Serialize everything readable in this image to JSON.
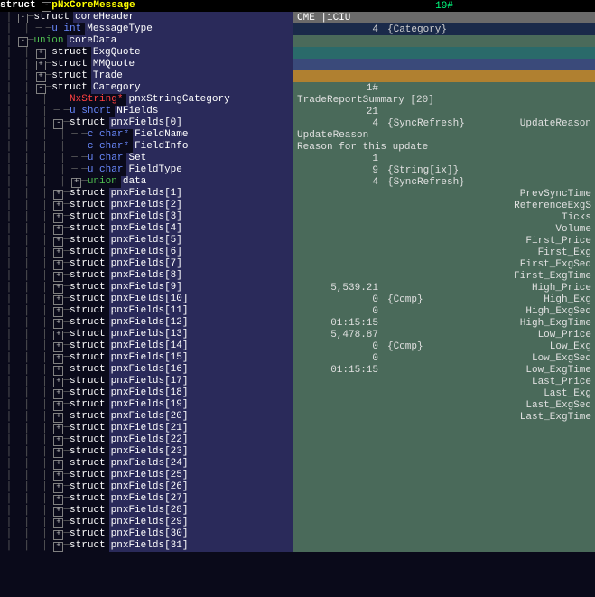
{
  "header": {
    "left_type": "struct",
    "left_name": "pNxCoreMessage",
    "right": "19#"
  },
  "rows": [
    {
      "i": 0,
      "ind": 1,
      "exp": "-",
      "type": "struct",
      "tcls": "type-struct",
      "name": "coreHeader",
      "rcls": "r-grey",
      "rtext": " CME |iCIU"
    },
    {
      "i": 1,
      "ind": 2,
      "exp": "",
      "type": "u int",
      "tcls": "type-uint",
      "name": "MessageType",
      "rcls": "r-dblue",
      "rnum": "4",
      "rtag": "{Category}"
    },
    {
      "i": 2,
      "ind": 1,
      "exp": "-",
      "type": "union",
      "tcls": "type-union",
      "name": "coreData",
      "rcls": "r-green",
      "rtext": ""
    },
    {
      "i": 3,
      "ind": 2,
      "exp": "+",
      "type": "struct",
      "tcls": "type-struct",
      "name": "ExgQuote",
      "rcls": "r-teal",
      "rtext": ""
    },
    {
      "i": 4,
      "ind": 2,
      "exp": "+",
      "type": "struct",
      "tcls": "type-struct",
      "name": "MMQuote",
      "rcls": "r-blue2",
      "rtext": ""
    },
    {
      "i": 5,
      "ind": 2,
      "exp": "+",
      "type": "struct",
      "tcls": "type-struct",
      "name": "Trade",
      "rcls": "r-orange",
      "rtext": ""
    },
    {
      "i": 6,
      "ind": 2,
      "exp": "-",
      "type": "struct",
      "tcls": "type-struct",
      "name": "Category",
      "rcls": "r-green",
      "rnum": "1#",
      "rtag": ""
    },
    {
      "i": 7,
      "ind": 3,
      "exp": "",
      "type": "NxString*",
      "tcls": "type-nxstr",
      "name": "pnxStringCategory",
      "rcls": "r-green",
      "rtext": " TradeReportSummary    [20]"
    },
    {
      "i": 8,
      "ind": 3,
      "exp": "",
      "type": "u short",
      "tcls": "type-ushort",
      "name": "NFields",
      "rcls": "r-green",
      "rnum": "21",
      "rtag": ""
    },
    {
      "i": 9,
      "ind": 3,
      "exp": "-",
      "type": "struct",
      "tcls": "type-struct",
      "name": "pnxFields[0]",
      "rcls": "r-green",
      "rnum": "4",
      "rtag": "{SyncRefresh}",
      "rend": "UpdateReason"
    },
    {
      "i": 10,
      "ind": 4,
      "exp": "",
      "type": "c char*",
      "tcls": "type-cchar",
      "name": "FieldName",
      "rcls": "r-green",
      "rtext": " UpdateReason"
    },
    {
      "i": 11,
      "ind": 4,
      "exp": "",
      "type": "c char*",
      "tcls": "type-cchar",
      "name": "FieldInfo",
      "rcls": "r-green",
      "rtext": " Reason for this update"
    },
    {
      "i": 12,
      "ind": 4,
      "exp": "",
      "type": "u char",
      "tcls": "type-uchar",
      "name": "Set",
      "rcls": "r-green",
      "rnum": "1",
      "rtag": ""
    },
    {
      "i": 13,
      "ind": 4,
      "exp": "",
      "type": "u char",
      "tcls": "type-uchar",
      "name": "FieldType",
      "rcls": "r-green",
      "rnum": "9",
      "rtag": "{String[ix]}"
    },
    {
      "i": 14,
      "ind": 4,
      "exp": "+",
      "type": "union",
      "tcls": "type-union",
      "name": "data",
      "rcls": "r-green",
      "rnum": "4",
      "rtag": "{SyncRefresh}"
    },
    {
      "i": 15,
      "ind": 3,
      "exp": "+",
      "type": "struct",
      "tcls": "type-struct",
      "name": "pnxFields[1]",
      "rcls": "r-green",
      "rend": "PrevSyncTime"
    },
    {
      "i": 16,
      "ind": 3,
      "exp": "+",
      "type": "struct",
      "tcls": "type-struct",
      "name": "pnxFields[2]",
      "rcls": "r-green",
      "rend": "ReferenceExgS"
    },
    {
      "i": 17,
      "ind": 3,
      "exp": "+",
      "type": "struct",
      "tcls": "type-struct",
      "name": "pnxFields[3]",
      "rcls": "r-green",
      "rend": "Ticks"
    },
    {
      "i": 18,
      "ind": 3,
      "exp": "+",
      "type": "struct",
      "tcls": "type-struct",
      "name": "pnxFields[4]",
      "rcls": "r-green",
      "rend": "Volume"
    },
    {
      "i": 19,
      "ind": 3,
      "exp": "+",
      "type": "struct",
      "tcls": "type-struct",
      "name": "pnxFields[5]",
      "rcls": "r-green",
      "rend": "First_Price"
    },
    {
      "i": 20,
      "ind": 3,
      "exp": "+",
      "type": "struct",
      "tcls": "type-struct",
      "name": "pnxFields[6]",
      "rcls": "r-green",
      "rend": "First_Exg"
    },
    {
      "i": 21,
      "ind": 3,
      "exp": "+",
      "type": "struct",
      "tcls": "type-struct",
      "name": "pnxFields[7]",
      "rcls": "r-green",
      "rend": "First_ExgSeq"
    },
    {
      "i": 22,
      "ind": 3,
      "exp": "+",
      "type": "struct",
      "tcls": "type-struct",
      "name": "pnxFields[8]",
      "rcls": "r-green",
      "rend": "First_ExgTime"
    },
    {
      "i": 23,
      "ind": 3,
      "exp": "+",
      "type": "struct",
      "tcls": "type-struct",
      "name": "pnxFields[9]",
      "rcls": "r-green",
      "rnum": "5,539.21",
      "rtag": "",
      "rend": "High_Price"
    },
    {
      "i": 24,
      "ind": 3,
      "exp": "+",
      "type": "struct",
      "tcls": "type-struct",
      "name": "pnxFields[10]",
      "rcls": "r-green",
      "rnum": "0",
      "rtag": "{Comp}",
      "rend": "High_Exg"
    },
    {
      "i": 25,
      "ind": 3,
      "exp": "+",
      "type": "struct",
      "tcls": "type-struct",
      "name": "pnxFields[11]",
      "rcls": "r-green",
      "rnum": "0",
      "rtag": "",
      "rend": "High_ExgSeq"
    },
    {
      "i": 26,
      "ind": 3,
      "exp": "+",
      "type": "struct",
      "tcls": "type-struct",
      "name": "pnxFields[12]",
      "rcls": "r-green",
      "rnum": "01:15:15",
      "rtag": "",
      "rend": "High_ExgTime"
    },
    {
      "i": 27,
      "ind": 3,
      "exp": "+",
      "type": "struct",
      "tcls": "type-struct",
      "name": "pnxFields[13]",
      "rcls": "r-green",
      "rnum": "5,478.87",
      "rtag": "",
      "rend": "Low_Price"
    },
    {
      "i": 28,
      "ind": 3,
      "exp": "+",
      "type": "struct",
      "tcls": "type-struct",
      "name": "pnxFields[14]",
      "rcls": "r-green",
      "rnum": "0",
      "rtag": "{Comp}",
      "rend": "Low_Exg"
    },
    {
      "i": 29,
      "ind": 3,
      "exp": "+",
      "type": "struct",
      "tcls": "type-struct",
      "name": "pnxFields[15]",
      "rcls": "r-green",
      "rnum": "0",
      "rtag": "",
      "rend": "Low_ExgSeq"
    },
    {
      "i": 30,
      "ind": 3,
      "exp": "+",
      "type": "struct",
      "tcls": "type-struct",
      "name": "pnxFields[16]",
      "rcls": "r-green",
      "rnum": "01:15:15",
      "rtag": "",
      "rend": "Low_ExgTime"
    },
    {
      "i": 31,
      "ind": 3,
      "exp": "+",
      "type": "struct",
      "tcls": "type-struct",
      "name": "pnxFields[17]",
      "rcls": "r-green",
      "rend": "Last_Price"
    },
    {
      "i": 32,
      "ind": 3,
      "exp": "+",
      "type": "struct",
      "tcls": "type-struct",
      "name": "pnxFields[18]",
      "rcls": "r-green",
      "rend": "Last_Exg"
    },
    {
      "i": 33,
      "ind": 3,
      "exp": "+",
      "type": "struct",
      "tcls": "type-struct",
      "name": "pnxFields[19]",
      "rcls": "r-green",
      "rend": "Last_ExgSeq"
    },
    {
      "i": 34,
      "ind": 3,
      "exp": "+",
      "type": "struct",
      "tcls": "type-struct",
      "name": "pnxFields[20]",
      "rcls": "r-green",
      "rend": "Last_ExgTime"
    },
    {
      "i": 35,
      "ind": 3,
      "exp": "+",
      "type": "struct",
      "tcls": "type-struct",
      "name": "pnxFields[21]",
      "rcls": "r-green"
    },
    {
      "i": 36,
      "ind": 3,
      "exp": "+",
      "type": "struct",
      "tcls": "type-struct",
      "name": "pnxFields[22]",
      "rcls": "r-green"
    },
    {
      "i": 37,
      "ind": 3,
      "exp": "+",
      "type": "struct",
      "tcls": "type-struct",
      "name": "pnxFields[23]",
      "rcls": "r-green"
    },
    {
      "i": 38,
      "ind": 3,
      "exp": "+",
      "type": "struct",
      "tcls": "type-struct",
      "name": "pnxFields[24]",
      "rcls": "r-green"
    },
    {
      "i": 39,
      "ind": 3,
      "exp": "+",
      "type": "struct",
      "tcls": "type-struct",
      "name": "pnxFields[25]",
      "rcls": "r-green"
    },
    {
      "i": 40,
      "ind": 3,
      "exp": "+",
      "type": "struct",
      "tcls": "type-struct",
      "name": "pnxFields[26]",
      "rcls": "r-green"
    },
    {
      "i": 41,
      "ind": 3,
      "exp": "+",
      "type": "struct",
      "tcls": "type-struct",
      "name": "pnxFields[27]",
      "rcls": "r-green"
    },
    {
      "i": 42,
      "ind": 3,
      "exp": "+",
      "type": "struct",
      "tcls": "type-struct",
      "name": "pnxFields[28]",
      "rcls": "r-green"
    },
    {
      "i": 43,
      "ind": 3,
      "exp": "+",
      "type": "struct",
      "tcls": "type-struct",
      "name": "pnxFields[29]",
      "rcls": "r-green"
    },
    {
      "i": 44,
      "ind": 3,
      "exp": "+",
      "type": "struct",
      "tcls": "type-struct",
      "name": "pnxFields[30]",
      "rcls": "r-green"
    },
    {
      "i": 45,
      "ind": 3,
      "exp": "+",
      "type": "struct",
      "tcls": "type-struct",
      "name": "pnxFields[31]",
      "rcls": "r-green"
    }
  ]
}
